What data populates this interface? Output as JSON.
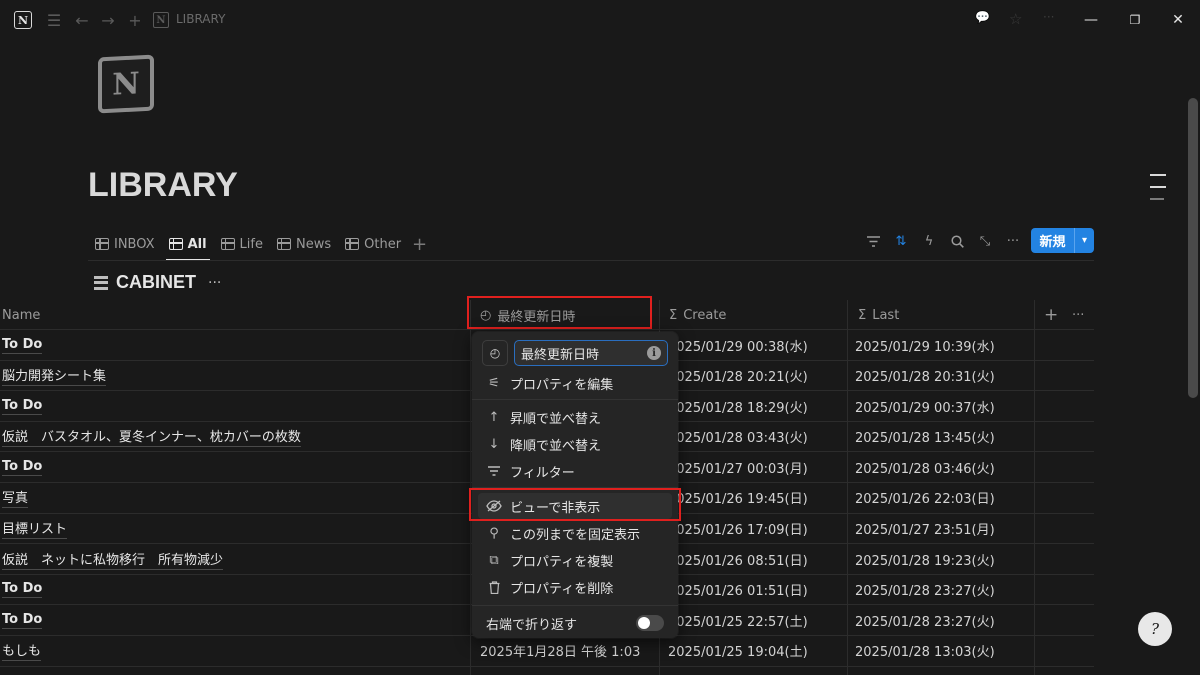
{
  "window": {
    "breadcrumb": "LIBRARY",
    "controls": {
      "minimize": "—",
      "restore": "❐",
      "close": "✕"
    }
  },
  "page": {
    "icon_letter": "N",
    "title": "LIBRARY"
  },
  "tabs": [
    {
      "label": "INBOX",
      "active": false
    },
    {
      "label": "All",
      "active": true
    },
    {
      "label": "Life",
      "active": false
    },
    {
      "label": "News",
      "active": false
    },
    {
      "label": "Other",
      "active": false
    }
  ],
  "toolbar": {
    "add_view": "+",
    "new_label": "新規",
    "icons": [
      "filter-icon",
      "sort-icon",
      "automation-icon",
      "search-icon",
      "expand-icon",
      "more-icon"
    ]
  },
  "database": {
    "name": "CABINET",
    "more": "···"
  },
  "table": {
    "columns": [
      {
        "label": "Name",
        "icon": ""
      },
      {
        "label": "最終更新日時",
        "icon": "clock-icon"
      },
      {
        "label": "Create",
        "icon": "sigma-icon"
      },
      {
        "label": "Last",
        "icon": "sigma-icon"
      }
    ],
    "add_column": "+",
    "column_more": "···",
    "rows": [
      {
        "name": "To Do",
        "bold": true,
        "updated": "",
        "create": "2025/01/29 00:38(水)",
        "last": "2025/01/29 10:39(水)"
      },
      {
        "name": "脳力開発シート集",
        "bold": false,
        "updated": "",
        "create": "2025/01/28 20:21(火)",
        "last": "2025/01/28 20:31(火)"
      },
      {
        "name": "To Do",
        "bold": true,
        "updated": "",
        "create": "2025/01/28 18:29(火)",
        "last": "2025/01/29 00:37(水)"
      },
      {
        "name": "仮説　バスタオル、夏冬インナー、枕カバーの枚数",
        "bold": false,
        "updated": "",
        "create": "2025/01/28 03:43(火)",
        "last": "2025/01/28 13:45(火)"
      },
      {
        "name": "To Do",
        "bold": true,
        "updated": "",
        "create": "2025/01/27 00:03(月)",
        "last": "2025/01/28 03:46(火)"
      },
      {
        "name": "写真",
        "bold": false,
        "updated": "",
        "create": "2025/01/26 19:45(日)",
        "last": "2025/01/26 22:03(日)"
      },
      {
        "name": "目標リスト",
        "bold": false,
        "updated": "",
        "create": "2025/01/26 17:09(日)",
        "last": "2025/01/27 23:51(月)"
      },
      {
        "name": "仮説　ネットに私物移行　所有物減少",
        "bold": false,
        "updated": "",
        "create": "2025/01/26 08:51(日)",
        "last": "2025/01/28 19:23(火)"
      },
      {
        "name": "To Do",
        "bold": true,
        "updated": "",
        "create": "2025/01/26 01:51(日)",
        "last": "2025/01/28 23:27(火)"
      },
      {
        "name": "To Do",
        "bold": true,
        "updated": "",
        "create": "2025/01/25 22:57(土)",
        "last": "2025/01/28 23:27(火)"
      },
      {
        "name": "もしも",
        "bold": false,
        "updated": "2025年1月28日 午後 1:03",
        "create": "2025/01/25 19:04(土)",
        "last": "2025/01/28 13:03(火)"
      }
    ]
  },
  "menu": {
    "property_name": "最終更新日時",
    "items": [
      {
        "label": "プロパティを編集",
        "icon": "sliders-icon"
      },
      {
        "label": "昇順で並べ替え",
        "icon": "arrow-up-icon"
      },
      {
        "label": "降順で並べ替え",
        "icon": "arrow-down-icon"
      },
      {
        "label": "フィルター",
        "icon": "filter-icon"
      },
      {
        "label": "ビューで非表示",
        "icon": "eye-slash-icon"
      },
      {
        "label": "この列までを固定表示",
        "icon": "pin-icon"
      },
      {
        "label": "プロパティを複製",
        "icon": "duplicate-icon"
      },
      {
        "label": "プロパティを削除",
        "icon": "trash-icon"
      }
    ],
    "wrap_label": "右端で折り返す",
    "wrap_on": false
  },
  "colors": {
    "background": "#191919",
    "accent": "#2383e2",
    "highlight_box": "#e0201e"
  }
}
